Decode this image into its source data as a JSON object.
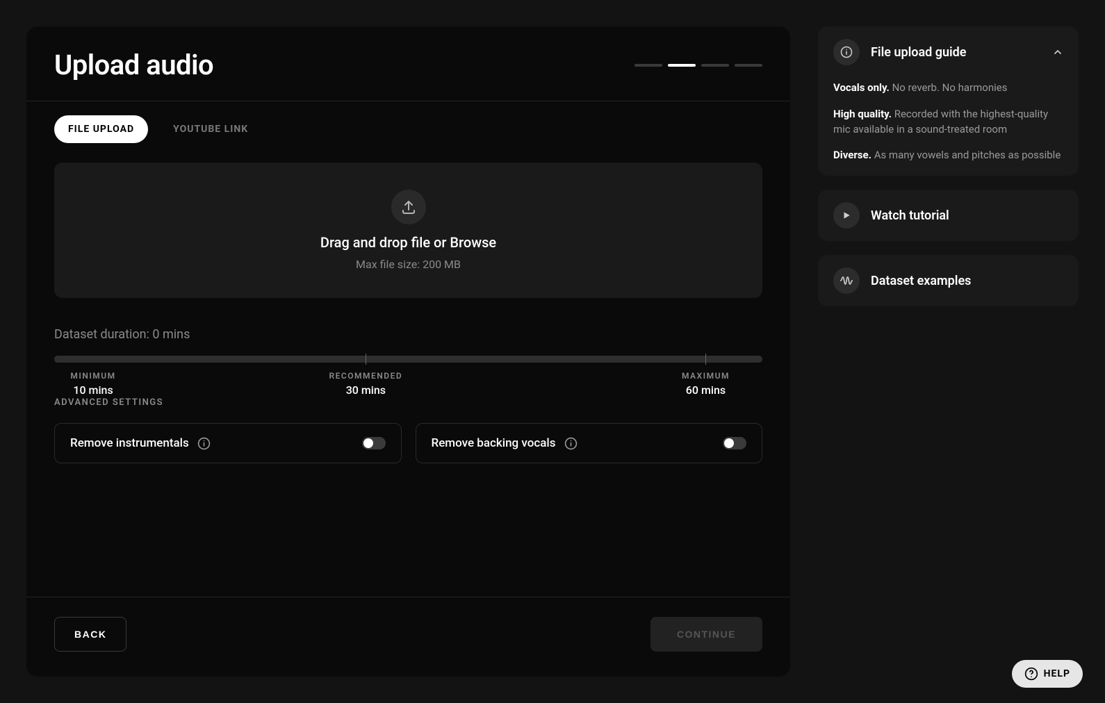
{
  "header": {
    "title": "Upload audio",
    "step_active_index": 1,
    "step_count": 4
  },
  "tabs": [
    {
      "label": "FILE UPLOAD",
      "active": true
    },
    {
      "label": "YOUTUBE LINK",
      "active": false
    }
  ],
  "dropzone": {
    "primary": "Drag and drop file or Browse",
    "secondary": "Max file size: 200 MB"
  },
  "duration": {
    "label": "Dataset duration: 0 mins",
    "minimum_label": "MINIMUM",
    "minimum_value": "10 mins",
    "recommended_label": "RECOMMENDED",
    "recommended_value": "30 mins",
    "maximum_label": "MAXIMUM",
    "maximum_value": "60 mins"
  },
  "advanced": {
    "heading": "ADVANCED SETTINGS",
    "toggles": [
      {
        "label": "Remove instrumentals",
        "on": false
      },
      {
        "label": "Remove backing vocals",
        "on": false
      }
    ]
  },
  "footer": {
    "back": "BACK",
    "continue": "CONTINUE"
  },
  "guide": {
    "title": "File upload guide",
    "items": [
      {
        "bold": "Vocals only.",
        "rest": " No reverb. No harmonies"
      },
      {
        "bold": "High quality.",
        "rest": " Recorded with the highest-quality mic available in a sound-treated room"
      },
      {
        "bold": "Diverse.",
        "rest": " As many vowels and pitches as possible"
      }
    ]
  },
  "side_links": {
    "tutorial": "Watch tutorial",
    "examples": "Dataset examples"
  },
  "help": {
    "label": "HELP"
  }
}
